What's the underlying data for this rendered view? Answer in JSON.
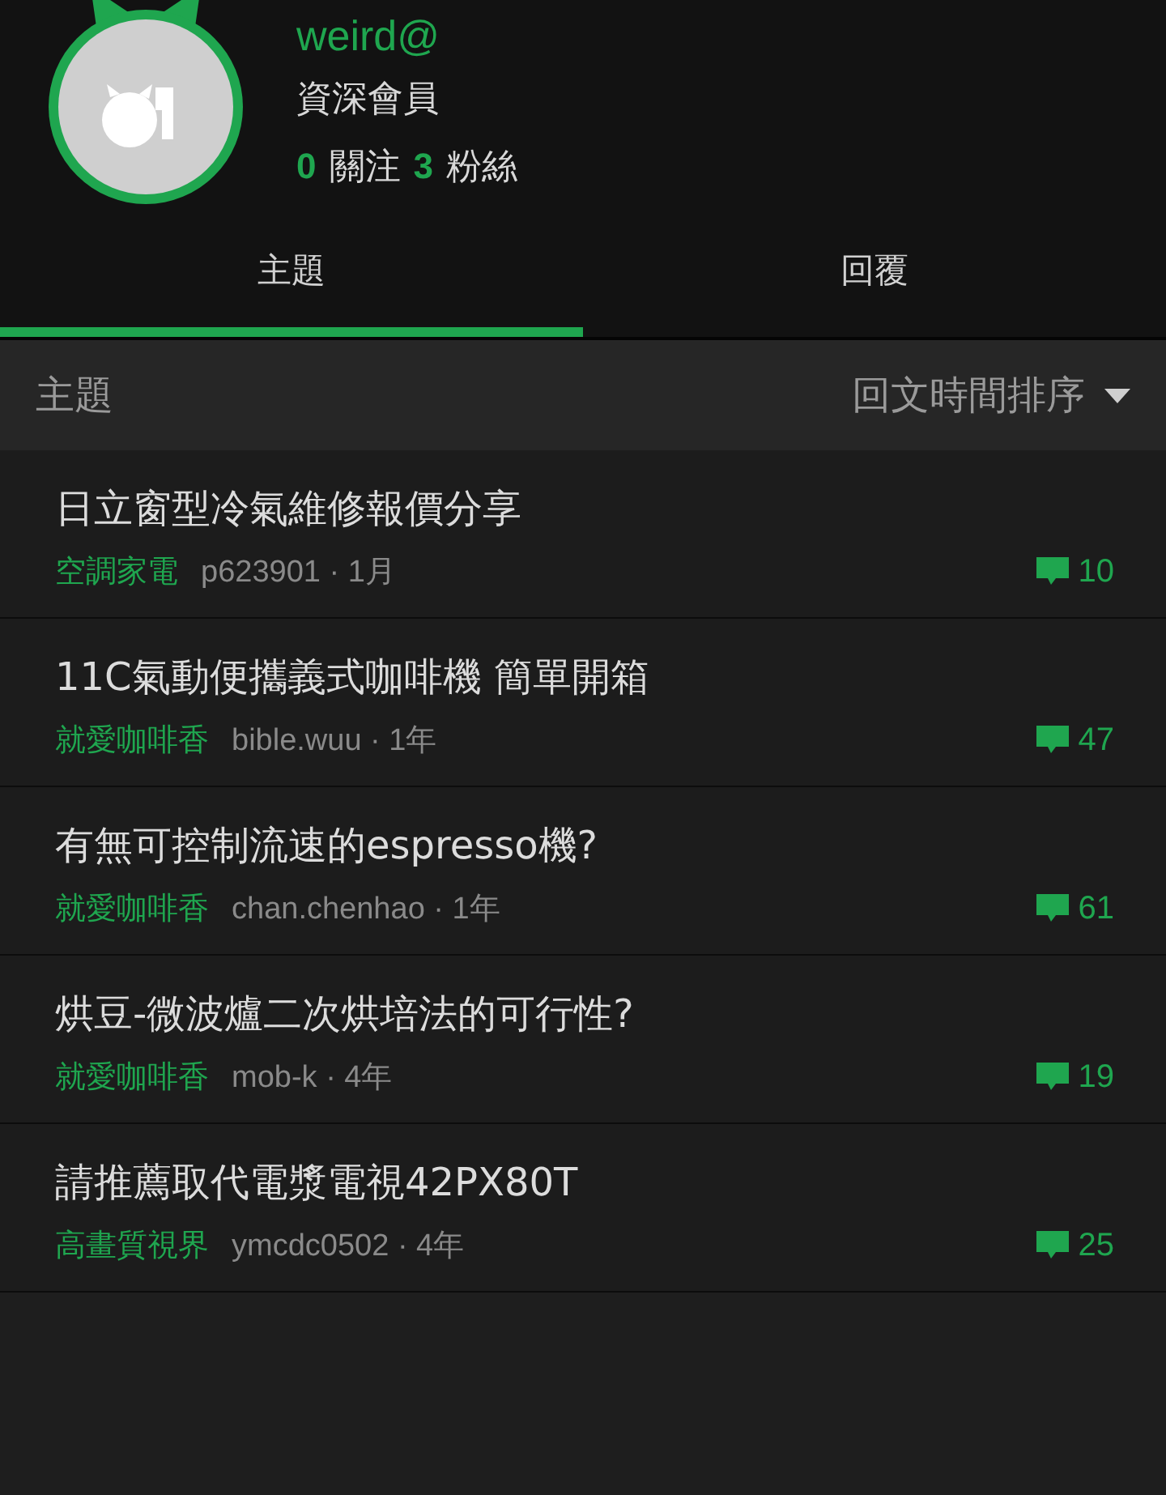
{
  "profile": {
    "username": "weird@",
    "rank": "資深會員",
    "stats": [
      {
        "count": "0",
        "label": "關注"
      },
      {
        "count": "3",
        "label": "粉絲"
      }
    ]
  },
  "tabs": [
    {
      "label": "主題",
      "selected": true
    },
    {
      "label": "回覆",
      "selected": false
    }
  ],
  "filter": {
    "label": "主題",
    "sort": "回文時間排序"
  },
  "topics": [
    {
      "title": "日立窗型冷氣維修報價分享",
      "forum": "空調家電",
      "meta": "p623901 · 1月",
      "replies": "10"
    },
    {
      "title": "11C氣動便攜義式咖啡機 簡單開箱",
      "forum": "就愛咖啡香",
      "meta": "bible.wuu · 1年",
      "replies": "47"
    },
    {
      "title": "有無可控制流速的espresso機?",
      "forum": "就愛咖啡香",
      "meta": "chan.chenhao · 1年",
      "replies": "61"
    },
    {
      "title": "烘豆-微波爐二次烘培法的可行性?",
      "forum": "就愛咖啡香",
      "meta": "mob-k · 4年",
      "replies": "19"
    },
    {
      "title": "請推薦取代電漿電視42PX80T",
      "forum": "高畫質視界",
      "meta": "ymcdc0502 · 4年",
      "replies": "25"
    }
  ]
}
